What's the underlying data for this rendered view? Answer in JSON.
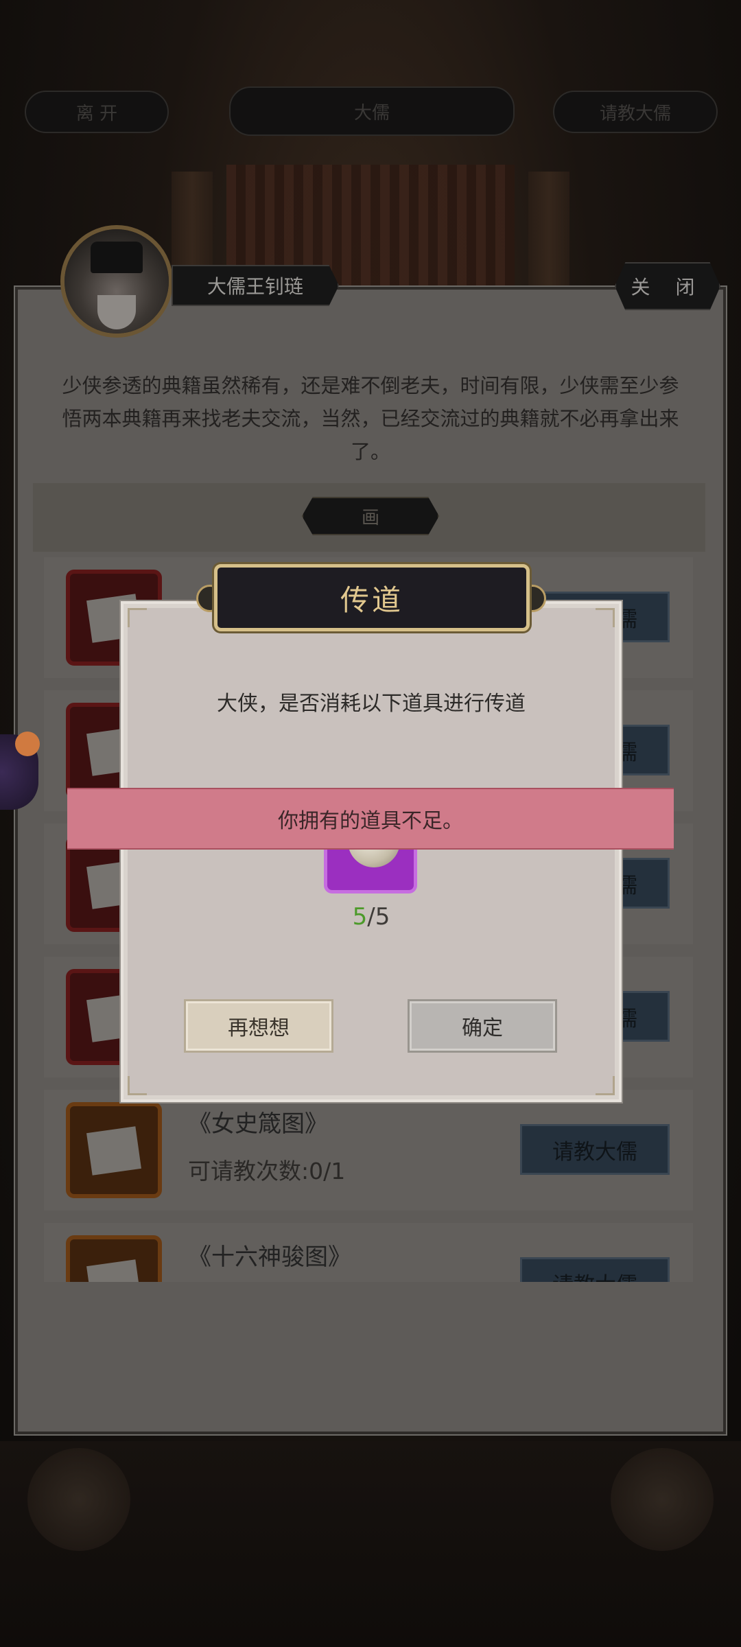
{
  "top_bar": {
    "leave_label": "离 开",
    "center_label": "大儒",
    "right_label": "请教大儒"
  },
  "npc": {
    "name": "大儒王钊琏",
    "close_label": "关 闭",
    "intro": "少侠参透的典籍虽然稀有，还是难不倒老夫，时间有限，少侠需至少参悟两本典籍再来找老夫交流，当然，已经交流过的典籍就不必再拿出来了。"
  },
  "category": {
    "label": "画"
  },
  "books": [
    {
      "title": "",
      "subtitle": "",
      "button": "请教大儒",
      "icon": "scroll-painting-icon"
    },
    {
      "title": "",
      "subtitle": "",
      "button": "请教大儒",
      "icon": "scroll-painting-icon"
    },
    {
      "title": "",
      "subtitle": "",
      "button": "请教大儒",
      "icon": "scroll-painting-icon"
    },
    {
      "title": "",
      "subtitle": "",
      "button": "请教大儒",
      "icon": "scroll-painting-icon"
    },
    {
      "title": "《女史箴图》",
      "subtitle": "可请教次数:0/1",
      "button": "请教大儒",
      "icon": "scroll-painting-icon"
    },
    {
      "title": "《十六神骏图》",
      "subtitle": "",
      "button": "请教大儒",
      "icon": "scroll-painting-icon"
    }
  ],
  "dialog": {
    "title": "传道",
    "message": "大侠，是否消耗以下道具进行传道",
    "item_icon": "pearl-orb-icon",
    "count_have": "5",
    "count_sep": "/",
    "count_need": "5",
    "cancel_label": "再想想",
    "confirm_label": "确定",
    "colors": {
      "count_have": "#4c9a2a",
      "title": "#e2c88f",
      "item_frame": "#9b2fc0"
    }
  },
  "toast": {
    "message": "你拥有的道具不足。",
    "color": "#d07b8a"
  }
}
